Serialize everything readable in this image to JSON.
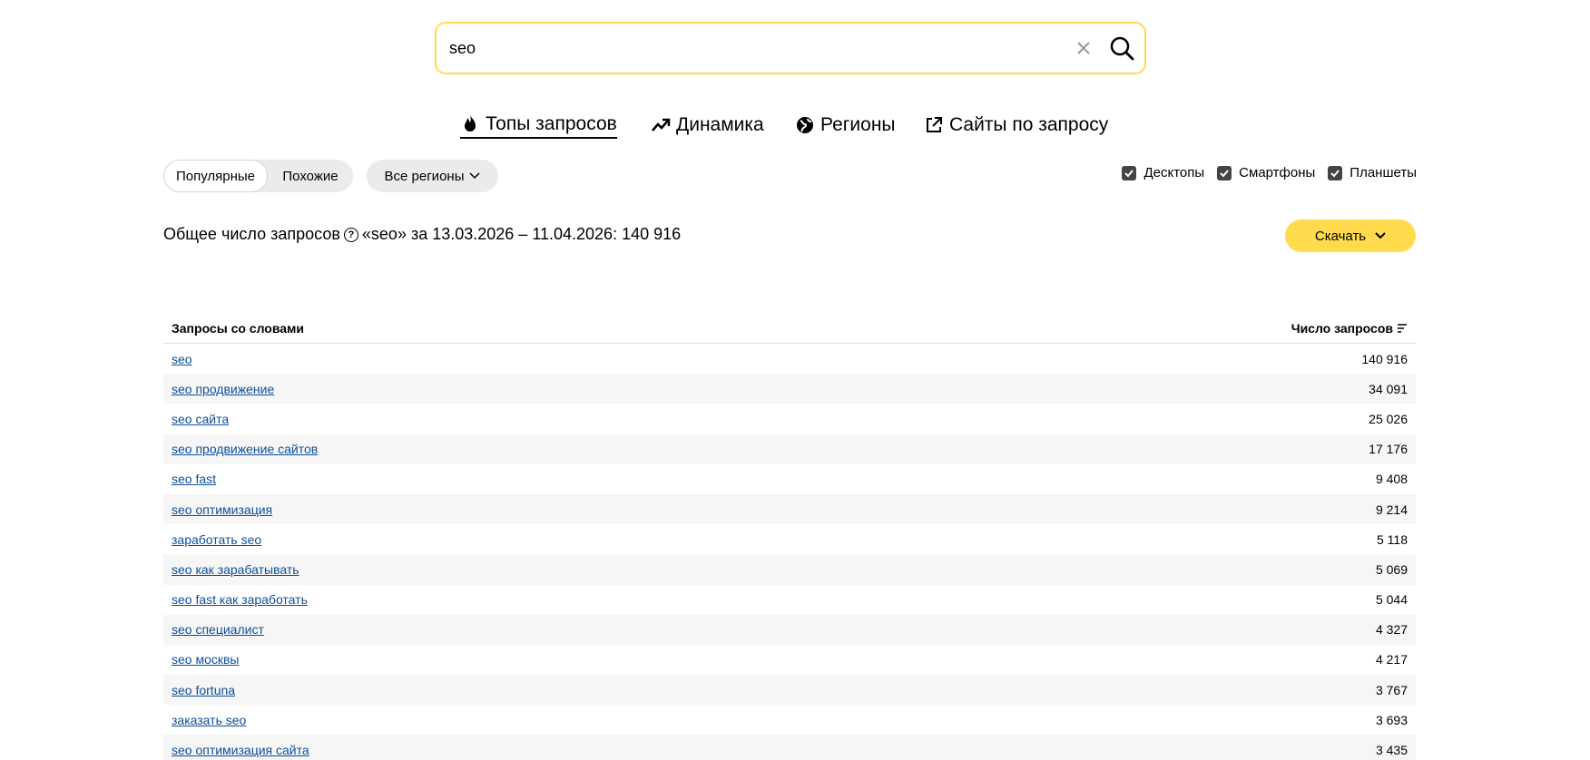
{
  "search": {
    "value": "seo"
  },
  "tabs": [
    {
      "label": "Топы запросов",
      "icon": "fire-icon",
      "active": true
    },
    {
      "label": "Динамика",
      "icon": "trend-up-icon"
    },
    {
      "label": "Регионы",
      "icon": "globe-icon"
    },
    {
      "label": "Сайты по запросу",
      "icon": "external-link-icon"
    }
  ],
  "filters": {
    "segment": [
      "Популярные",
      "Похожие"
    ],
    "region": "Все регионы",
    "devices": [
      {
        "label": "Десктопы",
        "checked": true
      },
      {
        "label": "Смартфоны",
        "checked": true
      },
      {
        "label": "Планшеты",
        "checked": true
      }
    ]
  },
  "summary": {
    "label": "Общее число запросов",
    "rest": "«seo» за 13.03.2026 – 11.04.2026: 140 916"
  },
  "download": {
    "label": "Скачать"
  },
  "table": {
    "col_query": "Запросы со словами",
    "col_count": "Число запросов",
    "rows": [
      {
        "query": "seo",
        "count": "140 916"
      },
      {
        "query": "seo продвижение",
        "count": "34 091"
      },
      {
        "query": "seo сайта",
        "count": "25 026"
      },
      {
        "query": "seo продвижение сайтов",
        "count": "17 176"
      },
      {
        "query": "seo fast",
        "count": "9 408"
      },
      {
        "query": "seo оптимизация",
        "count": "9 214"
      },
      {
        "query": "заработать seo",
        "count": "5 118"
      },
      {
        "query": "seo как зарабатывать",
        "count": "5 069"
      },
      {
        "query": "seo fast как заработать",
        "count": "5 044"
      },
      {
        "query": "seo специалист",
        "count": "4 327"
      },
      {
        "query": "seo москвы",
        "count": "4 217"
      },
      {
        "query": "seo fortuna",
        "count": "3 767"
      },
      {
        "query": "заказать seo",
        "count": "3 693"
      },
      {
        "query": "seo оптимизация сайта",
        "count": "3 435"
      }
    ]
  },
  "colors": {
    "accent": "#ffdb4d",
    "link": "#0f4f9a"
  }
}
